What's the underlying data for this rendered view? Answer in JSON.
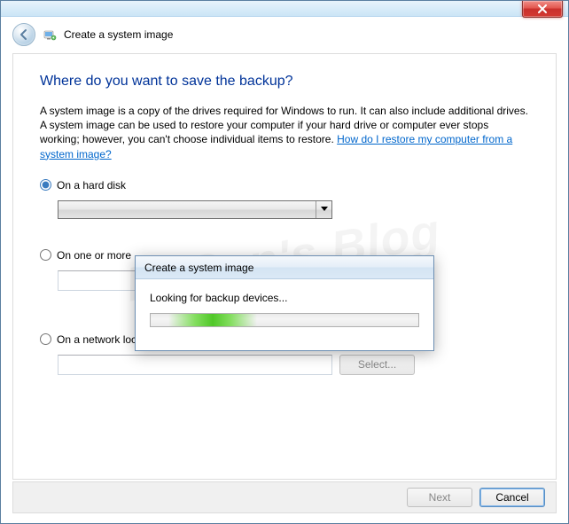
{
  "window": {
    "title": "Create a system image"
  },
  "header": {
    "heading": "Where do you want to save the backup?",
    "description_prefix": "A system image is a copy of the drives required for Windows to run. It can also include additional drives. A system image can be used to restore your computer if your hard drive or computer ever stops working; however, you can't choose individual items to restore. ",
    "link_text": "How do I restore my computer from a system image?"
  },
  "options": {
    "hard_disk": {
      "label": "On a hard disk",
      "checked": true
    },
    "dvd": {
      "label": "On one or more",
      "label_full_hidden": "On one or more DVDs",
      "checked": false
    },
    "network": {
      "label": "On a network location",
      "checked": false
    },
    "select_button": "Select..."
  },
  "progress_dialog": {
    "title": "Create a system image",
    "status": "Looking for backup devices..."
  },
  "buttons": {
    "next": "Next",
    "cancel": "Cancel"
  },
  "watermark": "N. Sen's Blog"
}
